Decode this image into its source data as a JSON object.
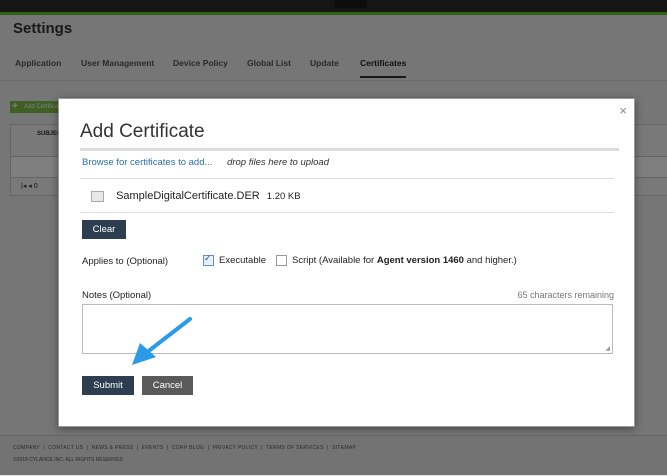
{
  "page": {
    "title": "Settings",
    "tabs": [
      {
        "label": "Application"
      },
      {
        "label": "User Management"
      },
      {
        "label": "Device Policy"
      },
      {
        "label": "Global List"
      },
      {
        "label": "Update"
      },
      {
        "label": "Certificates",
        "active": true
      }
    ],
    "add_button_label": "Add Certificate",
    "table": {
      "column_subject": "SUBJECT",
      "pager_text": "|◂  ◂  0"
    },
    "footer": {
      "links": [
        "COMPANY",
        "CONTACT US",
        "NEWS & PRESS",
        "EVENTS",
        "CORP BLOG",
        "PRIVACY POLICY",
        "TERMS OF SERVICES",
        "SITEMAP"
      ],
      "copyright": "©2018 CYLANCE INC. ALL RIGHTS RESERVED"
    }
  },
  "modal": {
    "title": "Add Certificate",
    "close_label": "×",
    "browse_link": "Browse for certificates to add...",
    "drop_hint": "drop files here to upload",
    "file": {
      "name": "SampleDigitalCertificate.DER",
      "size": "1.20 KB"
    },
    "clear_label": "Clear",
    "applies_label": "Applies to (Optional)",
    "option_executable": {
      "label": "Executable",
      "checked": true
    },
    "option_script": {
      "label_prefix": "Script (Available for ",
      "label_bold": "Agent version 1460",
      "label_suffix": " and higher.)",
      "checked": false
    },
    "notes_label": "Notes (Optional)",
    "chars_remaining": "65 characters remaining",
    "notes_value": "",
    "submit_label": "Submit",
    "cancel_label": "Cancel"
  },
  "colors": {
    "accent_green": "#5cbf2a",
    "dark_button": "#2d3e50",
    "cancel_button": "#5a5a5a",
    "link": "#2a6fa8",
    "arrow": "#2b9be8"
  }
}
